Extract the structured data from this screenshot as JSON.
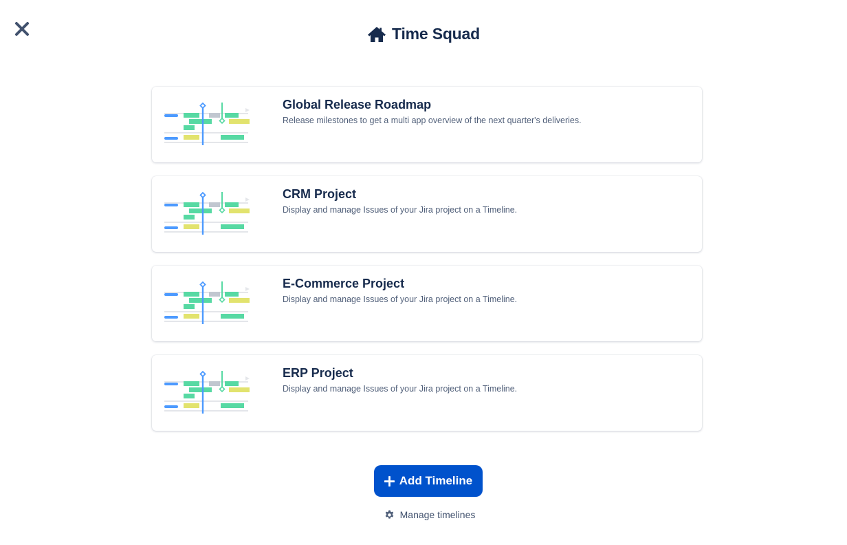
{
  "header": {
    "title": "Time Squad",
    "icon": "home-icon"
  },
  "close": {
    "icon": "close-icon"
  },
  "timelines": [
    {
      "title": "Global Release Roadmap",
      "description": "Release milestones to get a multi app overview of the next quarter's deliveries."
    },
    {
      "title": "CRM Project",
      "description": "Display and manage Issues of your Jira project on a Timeline."
    },
    {
      "title": "E-Commerce Project",
      "description": "Display and manage Issues of your Jira project on a Timeline."
    },
    {
      "title": "ERP Project",
      "description": "Display and manage Issues of your Jira project on a Timeline."
    }
  ],
  "actions": {
    "add_label": "Add Timeline",
    "manage_label": "Manage timelines"
  },
  "colors": {
    "primary": "#0052cc",
    "text_dark": "#172b4d",
    "text_muted": "#505f79",
    "bar_green": "#57d9a3",
    "bar_yellow": "#e2e36e",
    "bar_blue": "#4c9aff"
  }
}
